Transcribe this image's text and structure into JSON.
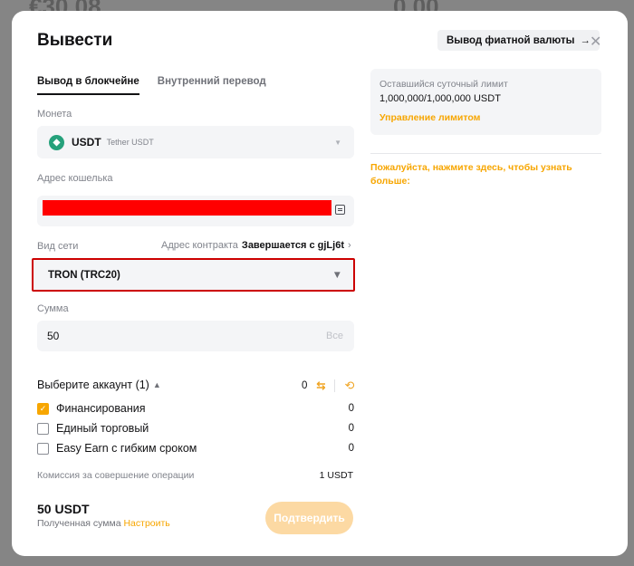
{
  "background": {
    "left_number": "€30.08",
    "right_number": "0.00"
  },
  "header": {
    "title": "Вывести",
    "fiat_button": "Вывод фиатной валюты",
    "close": "✕"
  },
  "tabs": [
    {
      "label": "Вывод в блокчейне"
    },
    {
      "label": "Внутренний перевод"
    }
  ],
  "coin": {
    "label": "Монета",
    "symbol": "USDT",
    "name": "Tether USDT",
    "icon": "tether-icon",
    "color": "#26a17b"
  },
  "wallet": {
    "label": "Адрес кошелька",
    "value": ""
  },
  "network": {
    "label": "Вид сети",
    "contract_label": "Адрес контракта",
    "contract_value": "Завершается с gjLj6t",
    "selected": "TRON (TRC20)"
  },
  "amount": {
    "label": "Сумма",
    "value": "50",
    "all_label": "Все"
  },
  "accounts": {
    "title": "Выберите аккаунт (1)",
    "total": "0",
    "items": [
      {
        "label": "Финансирования",
        "checked": true,
        "value": "0"
      },
      {
        "label": "Единый торговый",
        "checked": false,
        "value": "0"
      },
      {
        "label": "Easy Earn с гибким сроком",
        "checked": false,
        "value": "0"
      }
    ]
  },
  "fee": {
    "label": "Комиссия за совершение операции",
    "value": "1 USDT"
  },
  "summary": {
    "total": "50 USDT",
    "received_label": "Полученная сумма",
    "settings_link": "Настроить"
  },
  "confirm_button": "Подтвердить",
  "limit": {
    "label": "Оставшийся суточный лимит",
    "value": "1,000,000/1,000,000 USDT",
    "manage_link": "Управление лимитом"
  },
  "hint": "Пожалуйста, нажмите здесь, чтобы узнать больше:",
  "colors": {
    "accent": "#f7a600",
    "highlight_border": "#cc0000",
    "redaction": "#ff0000"
  }
}
